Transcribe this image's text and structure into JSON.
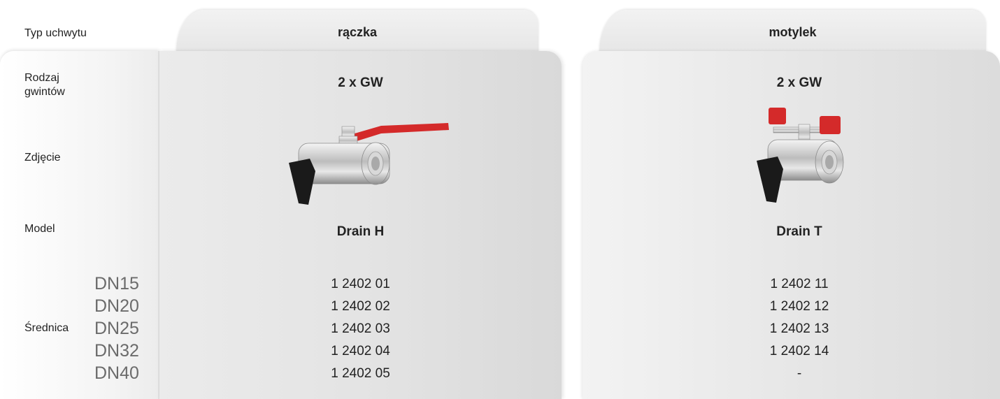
{
  "labels": {
    "handle_type": "Typ uchwytu",
    "thread_type": "Rodzaj\ngwintów",
    "photo": "Zdjęcie",
    "model": "Model",
    "diameter": "Średnica"
  },
  "diameters": [
    "DN15",
    "DN20",
    "DN25",
    "DN32",
    "DN40"
  ],
  "columns": [
    {
      "handle": "rączka",
      "thread": "2 x GW",
      "model": "Drain H",
      "codes": [
        "1 2402 01",
        "1 2402 02",
        "1 2402 03",
        "1 2402 04",
        "1 2402 05"
      ],
      "photo_icon": "ball-valve-lever-handle"
    },
    {
      "handle": "motylek",
      "thread": "2 x GW",
      "model": "Drain T",
      "codes": [
        "1 2402 11",
        "1 2402 12",
        "1 2402 13",
        "1 2402 14",
        "-"
      ],
      "photo_icon": "ball-valve-butterfly-handle"
    }
  ],
  "colors": {
    "handle_red": "#d42a2a",
    "drain_black": "#1a1a1a",
    "chrome": "#c8c8c8"
  }
}
